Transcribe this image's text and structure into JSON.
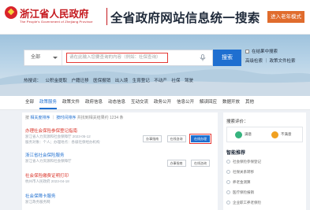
{
  "header": {
    "brand": "浙江省人民政府",
    "brand_sub": "The People's Government of Zhejiang Province",
    "title": "全省政府网站信息统一搜索",
    "old_version": "进入老年模式"
  },
  "search": {
    "scope": "全部",
    "query": "请在此输入您要查询的内容（例如：社保查询）",
    "button": "搜索",
    "option_in_results": "在结果中搜索",
    "option_links": "高级检索 ｜ 政策文件检索"
  },
  "hot": {
    "label": "热搜词：",
    "items": [
      "公积金提取",
      "户籍迁移",
      "医保报销",
      "出入境",
      "生育登记",
      "不动产",
      "社保",
      "驾驶"
    ]
  },
  "tabs": [
    {
      "label": "全部",
      "active": false
    },
    {
      "label": "政策服务",
      "active": true
    },
    {
      "label": "政策文件",
      "active": false
    },
    {
      "label": "政府信息",
      "active": false
    },
    {
      "label": "动态信息",
      "active": false
    },
    {
      "label": "互动交流",
      "active": false
    },
    {
      "label": "政务公开",
      "active": false
    },
    {
      "label": "信息公开",
      "active": false
    },
    {
      "label": "解读回应",
      "active": false
    },
    {
      "label": "数据开放",
      "active": false
    },
    {
      "label": "其他",
      "active": false
    }
  ],
  "filter": {
    "prefix": "按",
    "relevance": "相关度排序",
    "divider": "｜",
    "time": "按时间排序",
    "tail": "共找到相关结果约 1234 条"
  },
  "results": [
    {
      "title": "办理社会保险参保登记指南",
      "meta": "浙江省人力资源和社会保障厅 2023-05-12",
      "meta2": "服务对象：个人；办理地点：各级社保经办机构",
      "color": "#d93025",
      "buttons": [
        "办事指南",
        "在线咨询",
        "在线办理"
      ]
    },
    {
      "title": "浙江省社会保险服务",
      "meta": "浙江省人力资源和社会保障厅",
      "meta2": "",
      "color": "#1f6fd0",
      "buttons": [
        "办事指南",
        "在线咨询"
      ]
    },
    {
      "title": "社会保险缴费证明打印",
      "meta": "杭州市人民政府 2023-04-18",
      "meta2": "",
      "color": "#d93025",
      "buttons": []
    },
    {
      "title": "社会保障卡服务",
      "meta": "浙江政务服务网",
      "meta2": "",
      "color": "#1f6fd0",
      "buttons": []
    }
  ],
  "panel": {
    "eval_title": "搜索评价：",
    "eval_good": "满意",
    "eval_bad": "不满意",
    "rec_title": "智能推荐",
    "recommendations": [
      "社会保险参保登记",
      "社保关系转移",
      "养老金测算",
      "医疗保险报销",
      "企业职工养老保险"
    ]
  },
  "colors": {
    "brand_red": "#c4161c",
    "accent_blue": "#1f6fd0",
    "old_btn": "#e06c2d"
  }
}
